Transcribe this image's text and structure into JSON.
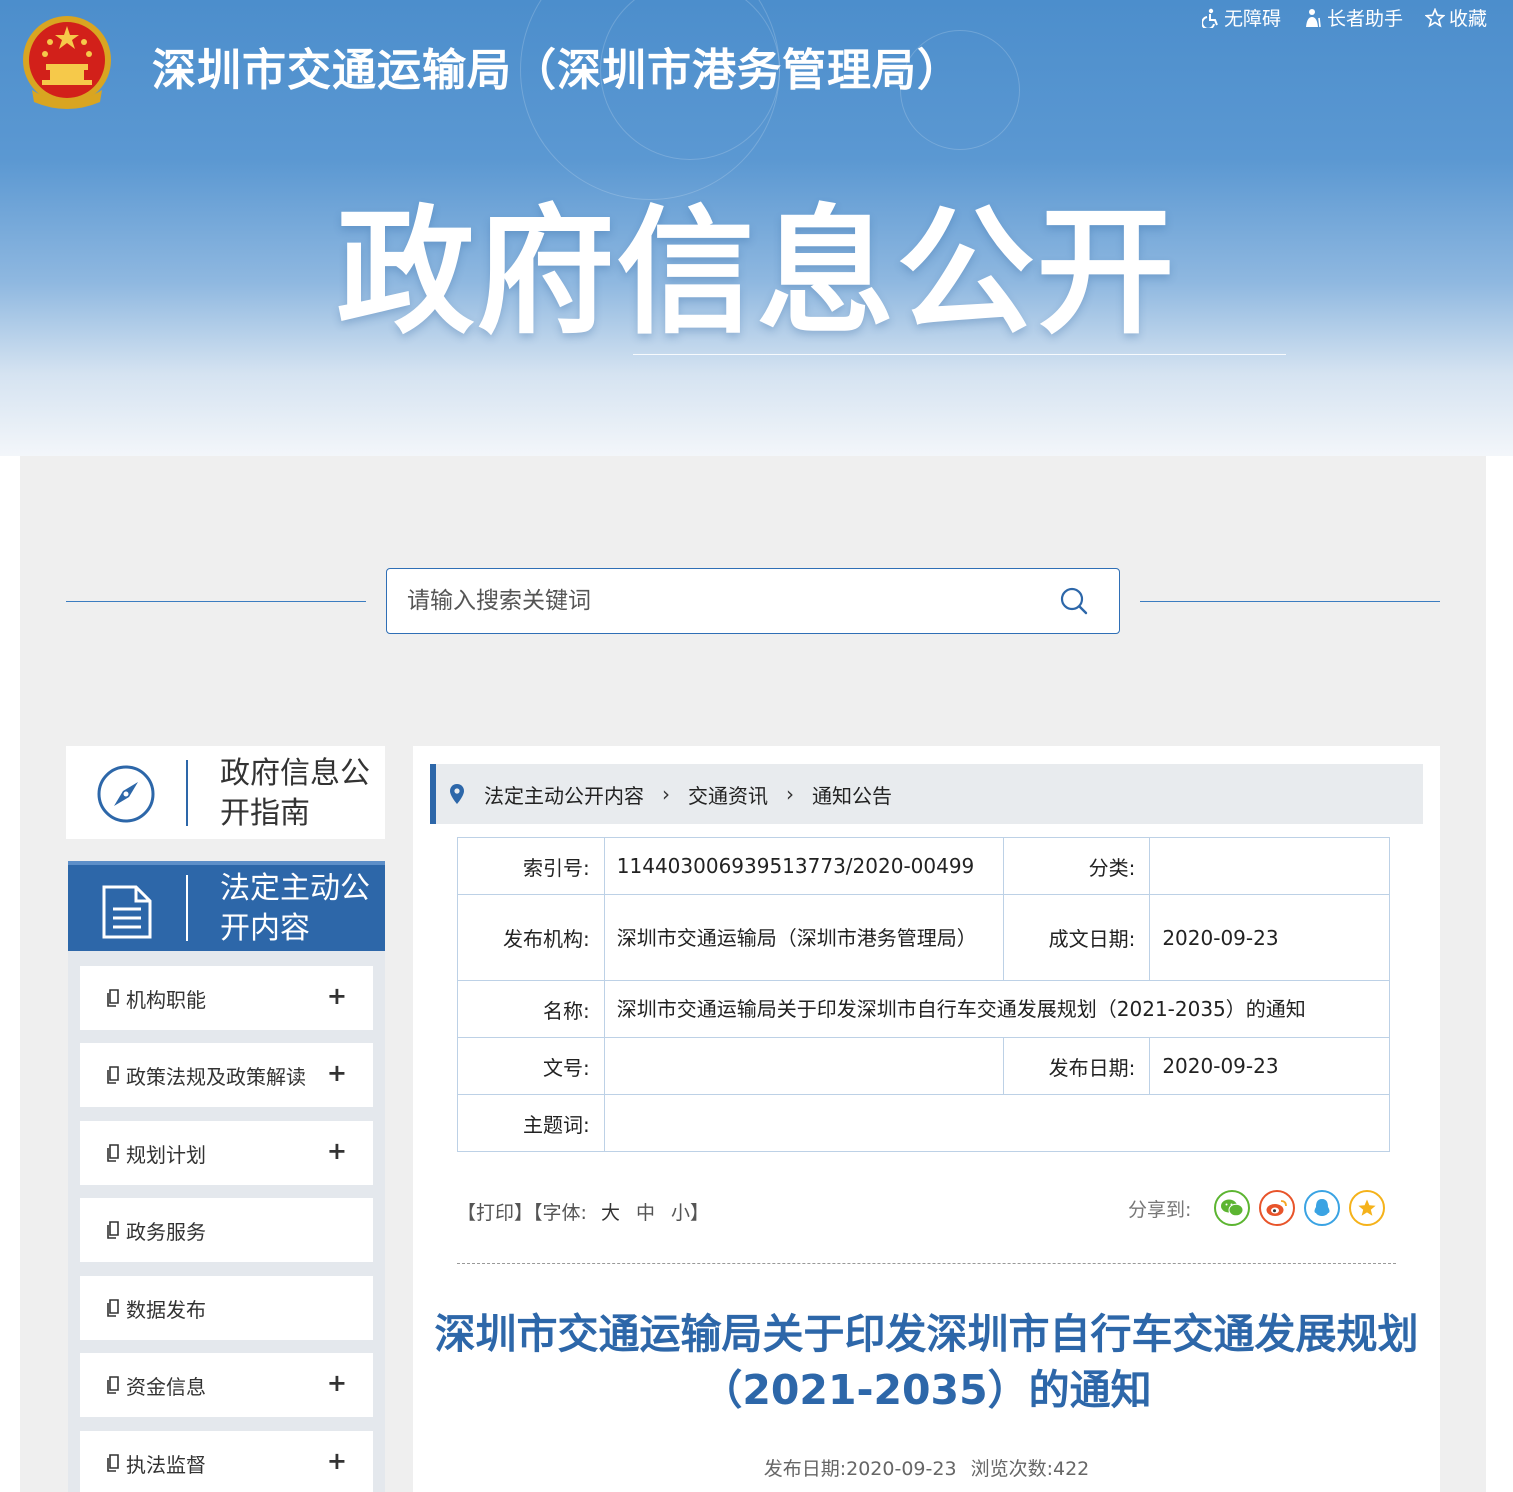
{
  "header": {
    "site_title": "深圳市交通运输局（深圳市港务管理局）",
    "top_links": [
      {
        "icon": "wheelchair-icon",
        "label": "无障碍"
      },
      {
        "icon": "elder-icon",
        "label": "长者助手"
      },
      {
        "icon": "star-icon",
        "label": "收藏"
      }
    ],
    "banner_title": "政府信息公开"
  },
  "search": {
    "placeholder": "请输入搜索关键词"
  },
  "sidebar": {
    "guide_label": "政府信息公开指南",
    "active_label": "法定主动公开内容",
    "items": [
      {
        "label": "机构职能",
        "expandable": true
      },
      {
        "label": "政策法规及政策解读",
        "expandable": true
      },
      {
        "label": "规划计划",
        "expandable": true
      },
      {
        "label": "政务服务",
        "expandable": false
      },
      {
        "label": "数据发布",
        "expandable": false
      },
      {
        "label": "资金信息",
        "expandable": true
      },
      {
        "label": "执法监督",
        "expandable": true
      }
    ],
    "expand_symbol": "+"
  },
  "breadcrumb": [
    "法定主动公开内容",
    "交通资讯",
    "通知公告"
  ],
  "meta": {
    "index_label": "索引号:",
    "index_value": "11440300693951377 3/2020-00499",
    "category_label": "分类:",
    "category_value": "",
    "publisher_label": "发布机构:",
    "publisher_value": "深圳市交通运输局（深圳市港务管理局）",
    "created_label": "成文日期:",
    "created_value": "2020-09-23",
    "name_label": "名称:",
    "name_value": "深圳市交通运输局关于印发深圳市自行车交通发展规划（2021-2035）的通知",
    "docno_label": "文号:",
    "docno_value": "",
    "pubdate_label": "发布日期:",
    "pubdate_value": "2020-09-23",
    "keywords_label": "主题词:",
    "keywords_value": ""
  },
  "tools": {
    "print": "【打印】",
    "font_prefix": "【字体:",
    "font_large": "大",
    "font_medium": "中",
    "font_small": "小",
    "font_suffix": "】",
    "share_label": "分享到:"
  },
  "share_colors": {
    "wechat": "#5cb531",
    "weibo": "#e8542a",
    "qq": "#3aa3e3",
    "qzone": "#f5b21a"
  },
  "article": {
    "title": "深圳市交通运输局关于印发深圳市自行车交通发展规划（2021-2035）的通知",
    "pubdate_label": "发布日期:",
    "pubdate": "2020-09-23",
    "views_label": "浏览次数:",
    "views": "422"
  }
}
